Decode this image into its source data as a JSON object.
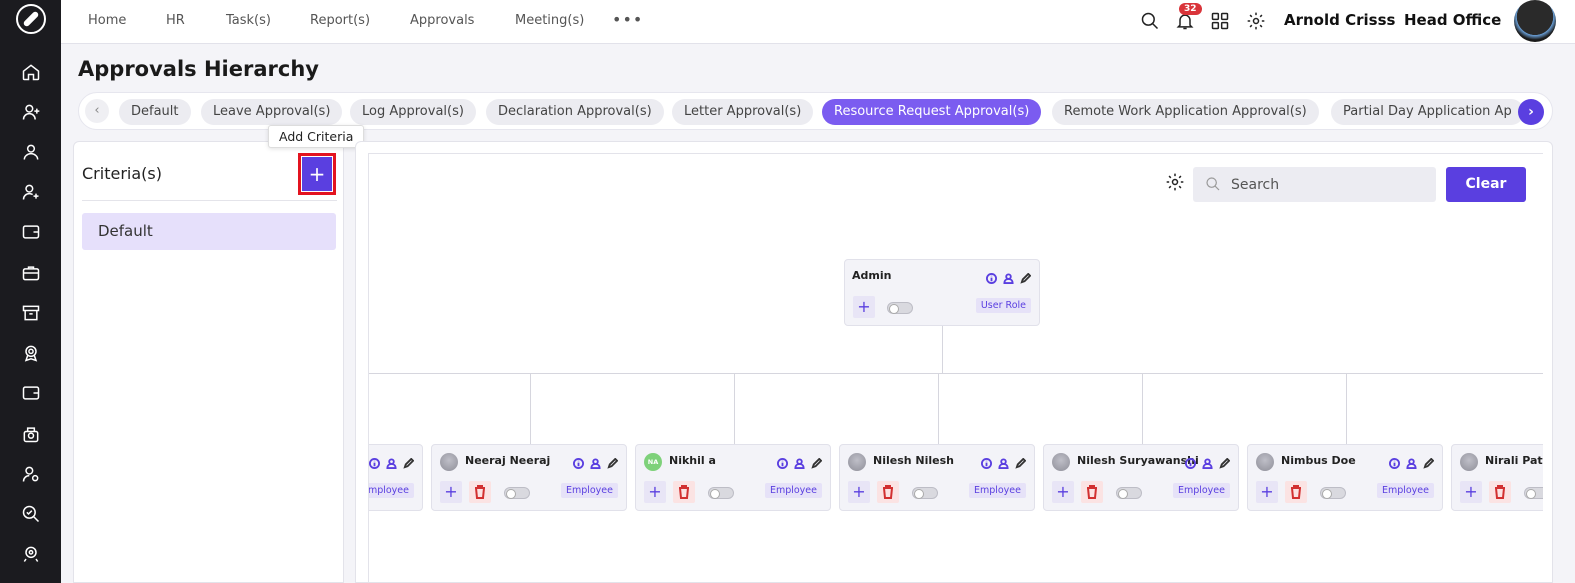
{
  "nav": {
    "links": [
      "Home",
      "HR",
      "Task(s)",
      "Report(s)",
      "Approvals",
      "Meeting(s)"
    ],
    "more_label": "•••",
    "notification_count": "32",
    "user_name": "Arnold Crisss",
    "office": "Head Office"
  },
  "sidebar_icons": [
    "home-icon",
    "user-add-icon",
    "user-icon",
    "user-plus-icon",
    "wallet-icon",
    "briefcase-icon",
    "archive-icon",
    "badge-icon",
    "card-icon",
    "gift-icon",
    "user-gear-icon",
    "search-check-icon",
    "headset-icon"
  ],
  "page": {
    "title": "Approvals Hierarchy"
  },
  "tabs": {
    "left_arrow": "‹",
    "right_arrow": "›",
    "items": [
      "Default",
      "Leave Approval(s)",
      "Log Approval(s)",
      "Declaration Approval(s)",
      "Letter Approval(s)",
      "Resource Request Approval(s)",
      "Remote Work Application Approval(s)",
      "Partial Day Application Ap"
    ],
    "active_index": 5
  },
  "tooltip": "Add Criteria",
  "criteria": {
    "title": "Criteria(s)",
    "add_label": "+",
    "items": [
      "Default"
    ]
  },
  "toolbar": {
    "search_placeholder": "Search",
    "clear_label": "Clear"
  },
  "hierarchy": {
    "root": {
      "name": "Admin",
      "role": "User Role",
      "add": "+"
    },
    "children": [
      {
        "name": "",
        "role": "mployee",
        "avatar": ""
      },
      {
        "name": "Neeraj Neeraj",
        "role": "Employee",
        "avatar": ""
      },
      {
        "name": "Nikhil a",
        "role": "Employee",
        "avatar": "NA"
      },
      {
        "name": "Nilesh Nilesh",
        "role": "Employee",
        "avatar": ""
      },
      {
        "name": "Nilesh Suryawanshi",
        "role": "Employee",
        "avatar": ""
      },
      {
        "name": "Nimbus Doe",
        "role": "Employee",
        "avatar": ""
      },
      {
        "name": "Nirali Pate",
        "role": "",
        "avatar": ""
      }
    ],
    "add": "+"
  },
  "colors": {
    "accent": "#5a3fe0",
    "active_tab": "#7b5cf0",
    "sidebar": "#1b1b1f",
    "highlight_border": "#e3131f",
    "badge": "#d9343a"
  }
}
